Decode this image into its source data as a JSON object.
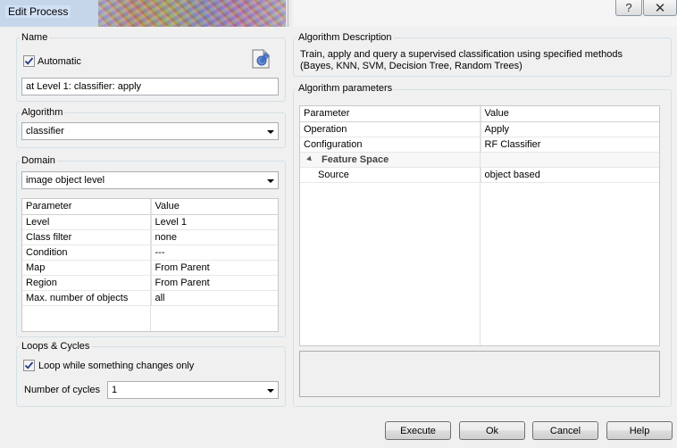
{
  "window": {
    "title": "Edit Process",
    "help_glyph": "?",
    "close_glyph": "✕"
  },
  "name_group": {
    "label": "Name",
    "automatic_label": "Automatic",
    "automatic_checked": true,
    "name_value": "at  Level 1: classifier: apply"
  },
  "algorithm_group": {
    "label": "Algorithm",
    "value": "classifier"
  },
  "domain_group": {
    "label": "Domain",
    "value": "image object level",
    "columns": [
      "Parameter",
      "Value"
    ],
    "rows": [
      [
        "Level",
        "Level 1"
      ],
      [
        "Class filter",
        "none"
      ],
      [
        "Condition",
        "---"
      ],
      [
        "Map",
        "From Parent"
      ],
      [
        "Region",
        "From Parent"
      ],
      [
        "Max. number of objects",
        "all"
      ]
    ]
  },
  "loops_group": {
    "label": "Loops & Cycles",
    "loop_label": "Loop while something changes only",
    "loop_checked": true,
    "cycles_label": "Number of cycles",
    "cycles_value": "1"
  },
  "description_group": {
    "label": "Algorithm Description",
    "text": "Train, apply and query a supervised classification using specified methods (Bayes, KNN, SVM, Decision Tree, Random Trees)"
  },
  "params_group": {
    "label": "Algorithm parameters",
    "columns": [
      "Parameter",
      "Value"
    ],
    "rows": [
      [
        "Operation",
        "Apply"
      ],
      [
        "Configuration",
        "RF Classifier"
      ]
    ],
    "section": "Feature Space",
    "section_rows": [
      [
        "Source",
        "object based"
      ]
    ]
  },
  "buttons": {
    "execute": "Execute",
    "ok": "Ok",
    "cancel": "Cancel",
    "help": "Help"
  }
}
